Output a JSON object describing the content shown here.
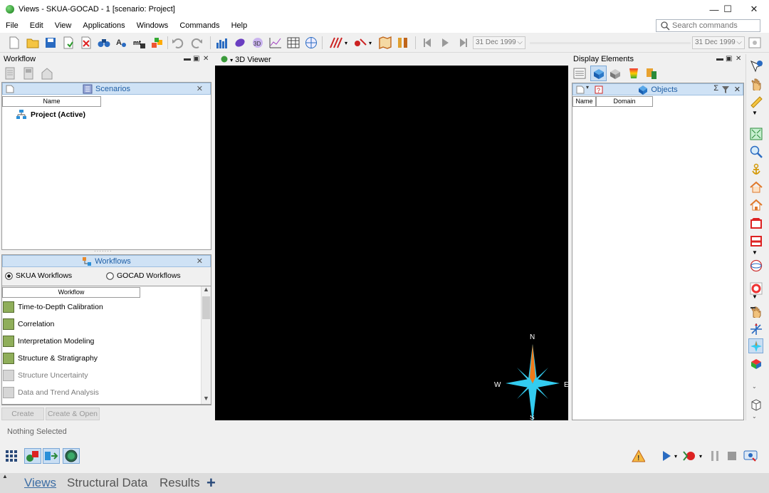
{
  "window": {
    "title": "Views - SKUA-GOCAD - 1  [scenario: Project]",
    "minimize": "—",
    "maximize": "☐",
    "close": "✕"
  },
  "menu": [
    "File",
    "Edit",
    "View",
    "Applications",
    "Windows",
    "Commands",
    "Help"
  ],
  "search": {
    "placeholder": "Search commands"
  },
  "toolbar": {
    "date_start": "31 Dec 1999",
    "date_end": "31 Dec 1999"
  },
  "workflow_panel": {
    "title": "Workflow",
    "scenarios_tab": "Scenarios",
    "name_column": "Name",
    "project_item": "Project (Active)"
  },
  "workflows_panel": {
    "title": "Workflows",
    "radio_skua": "SKUA Workflows",
    "radio_gocad": "GOCAD Workflows",
    "column": "Workflow",
    "items": [
      {
        "label": "Time-to-Depth Calibration",
        "enabled": true
      },
      {
        "label": "Correlation",
        "enabled": true
      },
      {
        "label": "Interpretation Modeling",
        "enabled": true
      },
      {
        "label": "Structure & Stratigraphy",
        "enabled": true
      },
      {
        "label": "Structure Uncertainty",
        "enabled": false
      },
      {
        "label": "Data and Trend Analysis",
        "enabled": false
      }
    ],
    "create_button": "Create",
    "create_open_button": "Create & Open"
  },
  "viewer": {
    "title": "3D Viewer",
    "compass": {
      "n": "N",
      "s": "S",
      "e": "E",
      "w": "W"
    }
  },
  "display_elements": {
    "title": "Display Elements",
    "objects_tab": "Objects",
    "col_name": "Name",
    "col_domain": "Domain"
  },
  "status": {
    "text": "Nothing Selected"
  },
  "tabs": [
    {
      "label": "Views",
      "active": true
    },
    {
      "label": "Structural Data",
      "active": false
    },
    {
      "label": "Results",
      "active": false
    }
  ],
  "add_tab": "+",
  "colors": {
    "accent": "#1f5fa6",
    "header_blue": "#cfe2f5",
    "viewer_bg": "#000000",
    "compass_orange": "#f07a1a",
    "compass_cyan": "#33ccf0"
  }
}
